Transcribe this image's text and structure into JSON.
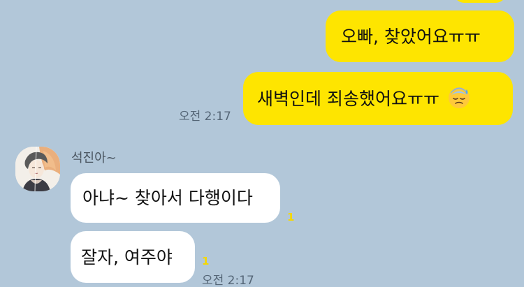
{
  "conversation": {
    "outgoing": [
      {
        "text": "오빠, 찾았어요ㅠㅠ"
      },
      {
        "text": "새벽인데 죄송했어요ㅠㅠ",
        "emoji": "downcast-sweat-face"
      }
    ],
    "outgoing_time": "오전 2:17",
    "sender_name": "석진아~",
    "incoming": [
      {
        "text": "아냐~ 찾아서 다행이다",
        "unread": "1"
      },
      {
        "text": "잘자, 여주야",
        "unread": "1"
      }
    ],
    "incoming_time": "오전 2:17"
  },
  "colors": {
    "background": "#b2c7d9",
    "outgoing_bubble": "#fee500",
    "incoming_bubble": "#ffffff",
    "unread_count": "#f5d800"
  }
}
